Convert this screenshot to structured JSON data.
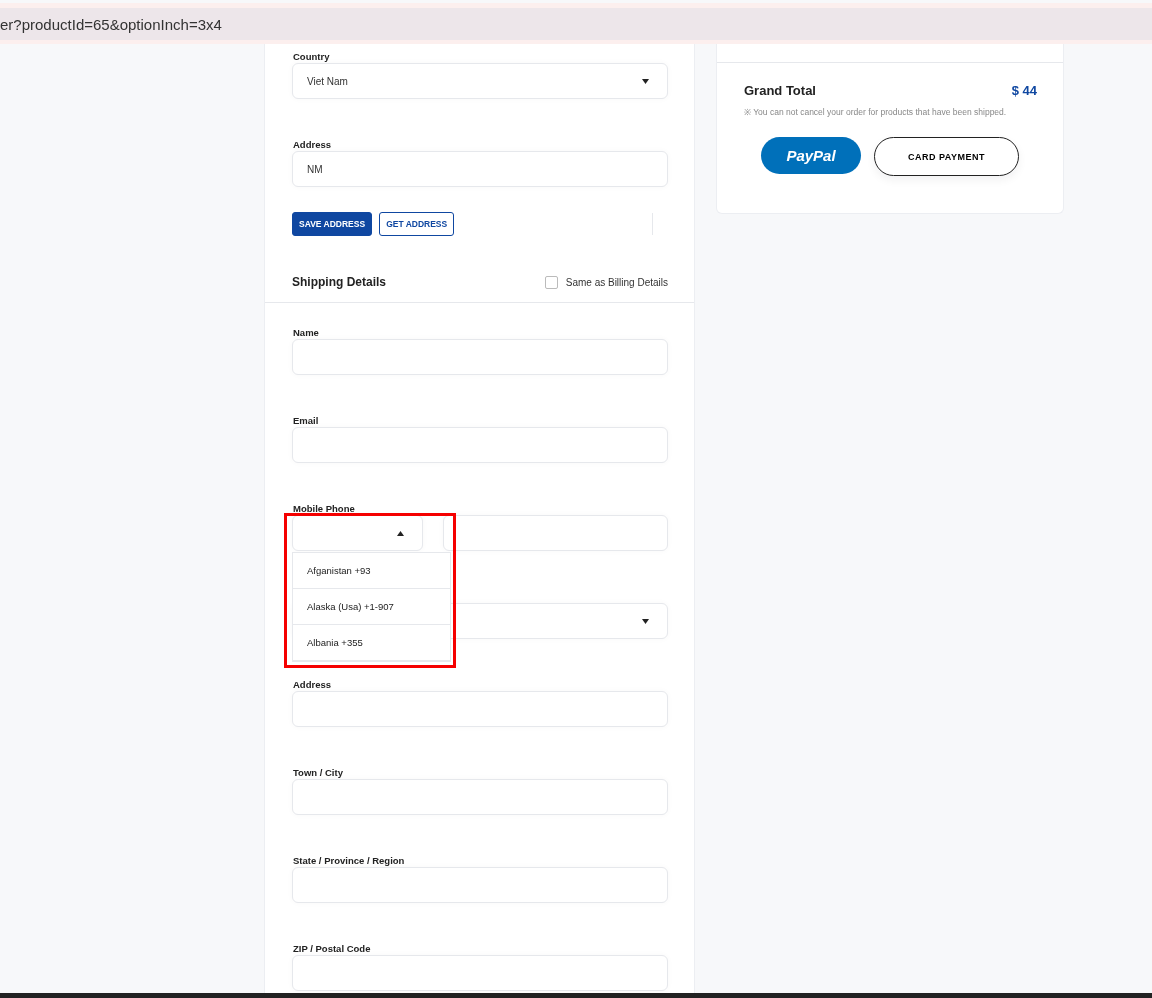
{
  "url_bar": {
    "url": "er?productId=65&optionInch=3x4"
  },
  "billing": {
    "fields": [
      {
        "kind": "select",
        "label": "Country",
        "value": "Viet Nam"
      },
      {
        "kind": "input",
        "label": "Address",
        "value": "NM"
      }
    ],
    "buttons": [
      {
        "label": "SAVE ADDRESS",
        "primary": true
      },
      {
        "label": "GET ADDRESS",
        "primary": false
      }
    ]
  },
  "shipping": {
    "title": "Shipping Details",
    "same_as_billing": {
      "label": "Same as Billing Details",
      "checked": false
    },
    "fields": [
      {
        "kind": "input",
        "label": "Name"
      },
      {
        "kind": "input",
        "label": "Email"
      },
      {
        "kind": "phone",
        "label": "Mobile Phone",
        "expanded": true,
        "highlighted": true,
        "options": [
          "Afganistan +93",
          "Alaska (Usa) +1-907",
          "Albania +355"
        ]
      },
      {
        "kind": "select"
      },
      {
        "kind": "input",
        "label": "Address"
      },
      {
        "kind": "input",
        "label": "Town / City"
      },
      {
        "kind": "input",
        "label": "State / Province / Region"
      },
      {
        "kind": "input",
        "label": "ZIP / Postal Code"
      }
    ]
  },
  "summary": {
    "grand_total_label": "Grand Total",
    "grand_total": "$ 44",
    "note": "※ You can not cancel your order for products that have been shipped.",
    "buttons": [
      {
        "kind": "paypal",
        "label": "PayPal"
      },
      {
        "kind": "card",
        "label": "CARD PAYMENT"
      }
    ]
  }
}
